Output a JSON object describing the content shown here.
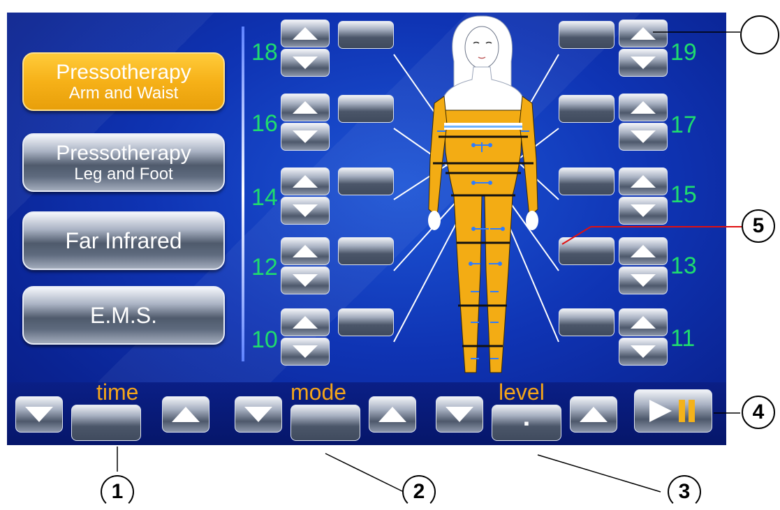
{
  "modes": [
    {
      "line1": "Pressotherapy",
      "line2": "Arm and Waist",
      "active": true
    },
    {
      "line1": "Pressotherapy",
      "line2": "Leg and Foot",
      "active": false
    },
    {
      "line1": "Far Infrared",
      "line2": "",
      "active": false
    },
    {
      "line1": "E.M.S.",
      "line2": "",
      "active": false
    }
  ],
  "zones_left": [
    {
      "number": "18",
      "value": ""
    },
    {
      "number": "16",
      "value": ""
    },
    {
      "number": "14",
      "value": ""
    },
    {
      "number": "12",
      "value": ""
    },
    {
      "number": "10",
      "value": ""
    }
  ],
  "zones_right": [
    {
      "number": "19",
      "value": ""
    },
    {
      "number": "17",
      "value": ""
    },
    {
      "number": "15",
      "value": ""
    },
    {
      "number": "13",
      "value": ""
    },
    {
      "number": "11",
      "value": ""
    }
  ],
  "bottom": {
    "time_label": "time",
    "time_value": "",
    "mode_label": "mode",
    "mode_value": "",
    "level_label": "level",
    "level_value": "▪"
  },
  "callouts": [
    "1",
    "2",
    "3",
    "4",
    "5",
    ""
  ],
  "icons": {
    "up": "up-arrow-icon",
    "down": "down-arrow-icon",
    "play_pause": "play-pause-icon"
  },
  "colors": {
    "screen_bg": "#0f34b4",
    "accent_orange": "#f6b118",
    "zone_number_green": "#1fdc6e",
    "label_orange": "#f3a51a",
    "body_fill": "#f3ac14"
  }
}
